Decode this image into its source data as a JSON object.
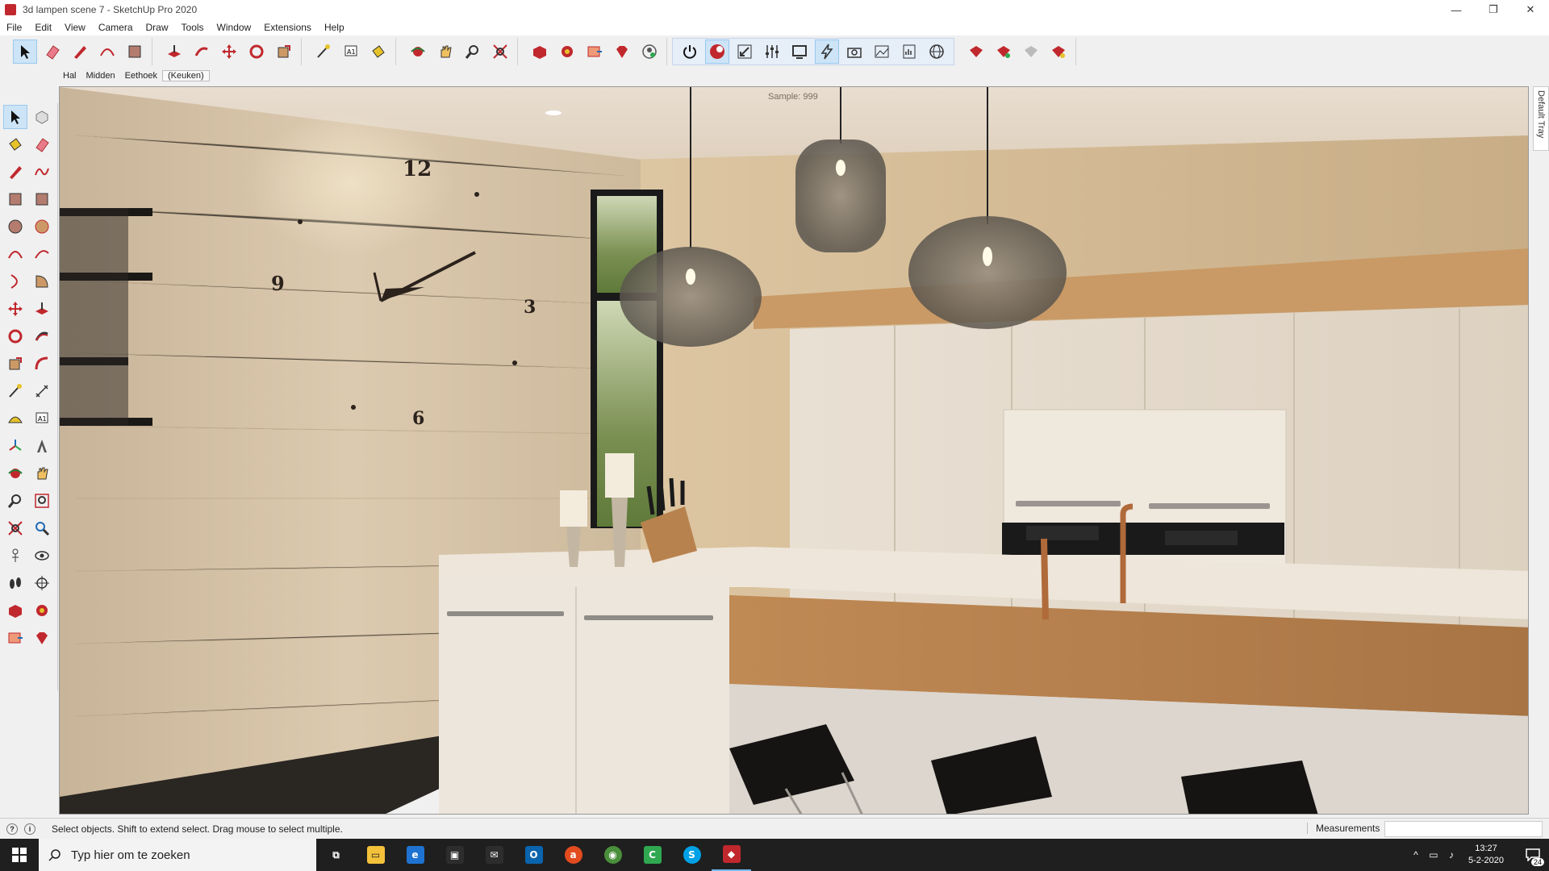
{
  "window": {
    "title": "3d lampen scene 7 - SketchUp Pro 2020",
    "minimize": "—",
    "maximize": "❐",
    "close": "✕"
  },
  "menu": [
    "File",
    "Edit",
    "View",
    "Camera",
    "Draw",
    "Tools",
    "Window",
    "Extensions",
    "Help"
  ],
  "scene_tabs": [
    {
      "label": "Hal",
      "active": false
    },
    {
      "label": "Midden",
      "active": false
    },
    {
      "label": "Eethoek",
      "active": false
    },
    {
      "label": "(Keuken)",
      "active": true
    }
  ],
  "viewport": {
    "sample_label": "Sample: 999",
    "clock_numbers": [
      "12",
      "9",
      "3",
      "6"
    ]
  },
  "tray": {
    "label": "Default Tray"
  },
  "status": {
    "message": "Select objects. Shift to extend select. Drag mouse to select multiple.",
    "measurements_label": "Measurements",
    "measurements_value": ""
  },
  "taskbar": {
    "search_placeholder": "Typ hier om te zoeken",
    "time": "13:27",
    "date": "5-2-2020",
    "notification_count": "24",
    "apps": [
      {
        "name": "task-view",
        "color": "#1f1f1f",
        "glyph": "⧉"
      },
      {
        "name": "file-explorer",
        "color": "#f3c13a",
        "glyph": "▭"
      },
      {
        "name": "edge",
        "color": "#1e73d2",
        "glyph": "e"
      },
      {
        "name": "store",
        "color": "#2d2d2d",
        "glyph": "▣"
      },
      {
        "name": "mail",
        "color": "#2d2d2d",
        "glyph": "✉"
      },
      {
        "name": "outlook",
        "color": "#0a64ad",
        "glyph": "O"
      },
      {
        "name": "act",
        "color": "#e24c1e",
        "glyph": "a"
      },
      {
        "name": "chrome",
        "color": "#4a8f3c",
        "glyph": "◉"
      },
      {
        "name": "camtasia",
        "color": "#2fa84f",
        "glyph": "C"
      },
      {
        "name": "skype",
        "color": "#00a1e6",
        "glyph": "S"
      },
      {
        "name": "sketchup",
        "color": "#c0282d",
        "glyph": "◆"
      }
    ]
  },
  "colors": {
    "accent_red": "#c0282d",
    "active_tool_bg": "#cde4f7",
    "taskbar_bg": "#1f1f1f"
  }
}
